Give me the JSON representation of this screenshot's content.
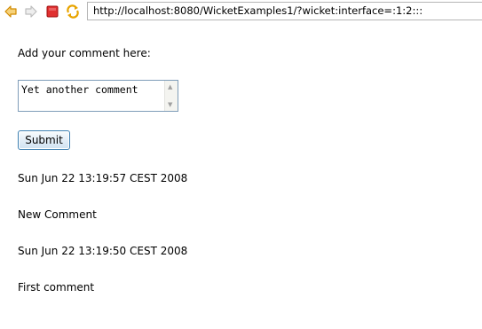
{
  "browser": {
    "url": "http://localhost:8080/WicketExamples1/?wicket:interface=:1:2:::",
    "icons": [
      "back-arrow-icon",
      "forward-arrow-icon",
      "stop-icon",
      "refresh-icon"
    ],
    "colors": {
      "back": "#e8a400",
      "stop": "#cc2222",
      "refresh": "#e8a400"
    }
  },
  "form": {
    "prompt": "Add your comment here:",
    "textarea_value": "Yet another comment",
    "submit_label": "Submit"
  },
  "comments": [
    {
      "date": "Sun Jun 22 13:19:57 CEST 2008",
      "text": "New Comment"
    },
    {
      "date": "Sun Jun 22 13:19:50 CEST 2008",
      "text": "First comment"
    }
  ]
}
